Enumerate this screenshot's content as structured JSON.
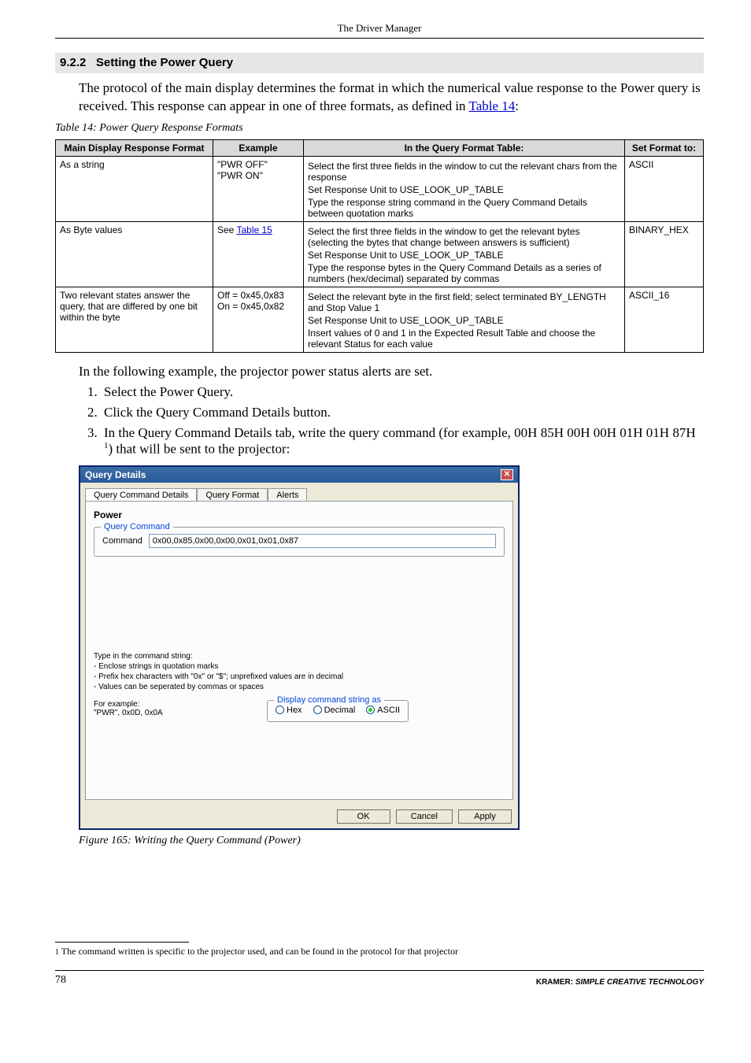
{
  "runningHead": "The Driver Manager",
  "section": {
    "number": "9.2.2",
    "title": "Setting the Power Query"
  },
  "intro": {
    "text1": "The protocol of the main display determines the format in which the numerical value response to the Power query is received. This response can appear in one of three formats, as defined in ",
    "link": "Table 14",
    "text2": ":"
  },
  "tableCaption": "Table 14: Power Query Response Formats",
  "tableHeaders": {
    "c1": "Main Display Response Format",
    "c2": "Example",
    "c3": "In the Query Format Table:",
    "c4": "Set Format to:"
  },
  "tableRows": [
    {
      "c1": "As a string",
      "c2": "\"PWR OFF\"\n\"PWR ON\"",
      "c3": [
        "Select the first three fields in the window to cut the relevant chars from the response",
        "Set Response Unit to USE_LOOK_UP_TABLE",
        "Type the response string command in the Query Command Details between quotation marks"
      ],
      "c4": "ASCII"
    },
    {
      "c1": "As Byte values",
      "c2_pre": "See ",
      "c2_link": "Table 15",
      "c3": [
        "Select the first three fields in the window to get the relevant bytes (selecting the bytes that change between answers is sufficient)",
        "Set Response Unit to USE_LOOK_UP_TABLE",
        "Type the response bytes in the Query Command Details as a series of numbers (hex/decimal) separated by commas"
      ],
      "c4": "BINARY_HEX"
    },
    {
      "c1": "Two relevant states answer the query, that are differed by one bit within the byte",
      "c2": "Off = 0x45,0x83\nOn = 0x45,0x82",
      "c3": [
        "Select the relevant byte in the first field; select terminated BY_LENGTH and Stop Value 1",
        "Set Response Unit to USE_LOOK_UP_TABLE",
        "Insert values of 0 and 1 in the Expected Result Table and choose the relevant Status for each value"
      ],
      "c4": "ASCII_16"
    }
  ],
  "afterTable": "In the following example, the projector power status alerts are set.",
  "steps": [
    "Select the Power Query.",
    "Click the Query Command Details button.",
    "In the Query Command Details tab, write the query command (for example, 00H 85H 00H 00H 01H 01H 87H "
  ],
  "stepSuffix": ") that will be sent to the projector:",
  "dialog": {
    "title": "Query Details",
    "tabs": [
      "Query Command Details",
      "Query Format",
      "Alerts"
    ],
    "powerLabel": "Power",
    "queryCmdLegend": "Query Command",
    "cmdLabel": "Command",
    "cmdValue": "0x00,0x85,0x00,0x00,0x01,0x01,0x87",
    "hints": [
      "Type in the command string:",
      "- Enclose strings in quotation marks",
      "- Prefix hex characters with \"0x\" or \"$\"; unprefixed values are in decimal",
      "- Values can be seperated by commas or spaces"
    ],
    "example": [
      "For example:",
      "\"PWR\", 0x0D, 0x0A"
    ],
    "radioLegend": "Display command string as",
    "radios": [
      "Hex",
      "Decimal",
      "ASCII"
    ],
    "buttons": {
      "ok": "OK",
      "cancel": "Cancel",
      "apply": "Apply"
    }
  },
  "figCaption": "Figure 165: Writing the Query Command (Power)",
  "footnote": {
    "marker": "1",
    "text": " The command written is specific to the projector used, and can be found in the protocol for that projector"
  },
  "footer": {
    "page": "78",
    "brandK": "KRAMER:",
    "brandRest": " SIMPLE CREATIVE TECHNOLOGY"
  },
  "chart_data": {
    "type": "table",
    "title": "Table 14: Power Query Response Formats",
    "columns": [
      "Main Display Response Format",
      "Example",
      "In the Query Format Table:",
      "Set Format to:"
    ],
    "rows": [
      [
        "As a string",
        "\"PWR OFF\" / \"PWR ON\"",
        "Select first three fields to cut relevant chars; Set Response Unit to USE_LOOK_UP_TABLE; Type response string in Query Command Details between quotation marks",
        "ASCII"
      ],
      [
        "As Byte values",
        "See Table 15",
        "Select first three fields to get relevant bytes (selecting bytes that change between answers is sufficient); Set Response Unit to USE_LOOK_UP_TABLE; Type response bytes as numbers (hex/decimal) separated by commas",
        "BINARY_HEX"
      ],
      [
        "Two relevant states answer the query, that are differed by one bit within the byte",
        "Off = 0x45,0x83 / On = 0x45,0x82",
        "Select relevant byte in first field; select terminated BY_LENGTH and Stop Value 1; Set Response Unit to USE_LOOK_UP_TABLE; Insert values 0 and 1 in Expected Result Table and choose relevant Status for each value",
        "ASCII_16"
      ]
    ]
  }
}
